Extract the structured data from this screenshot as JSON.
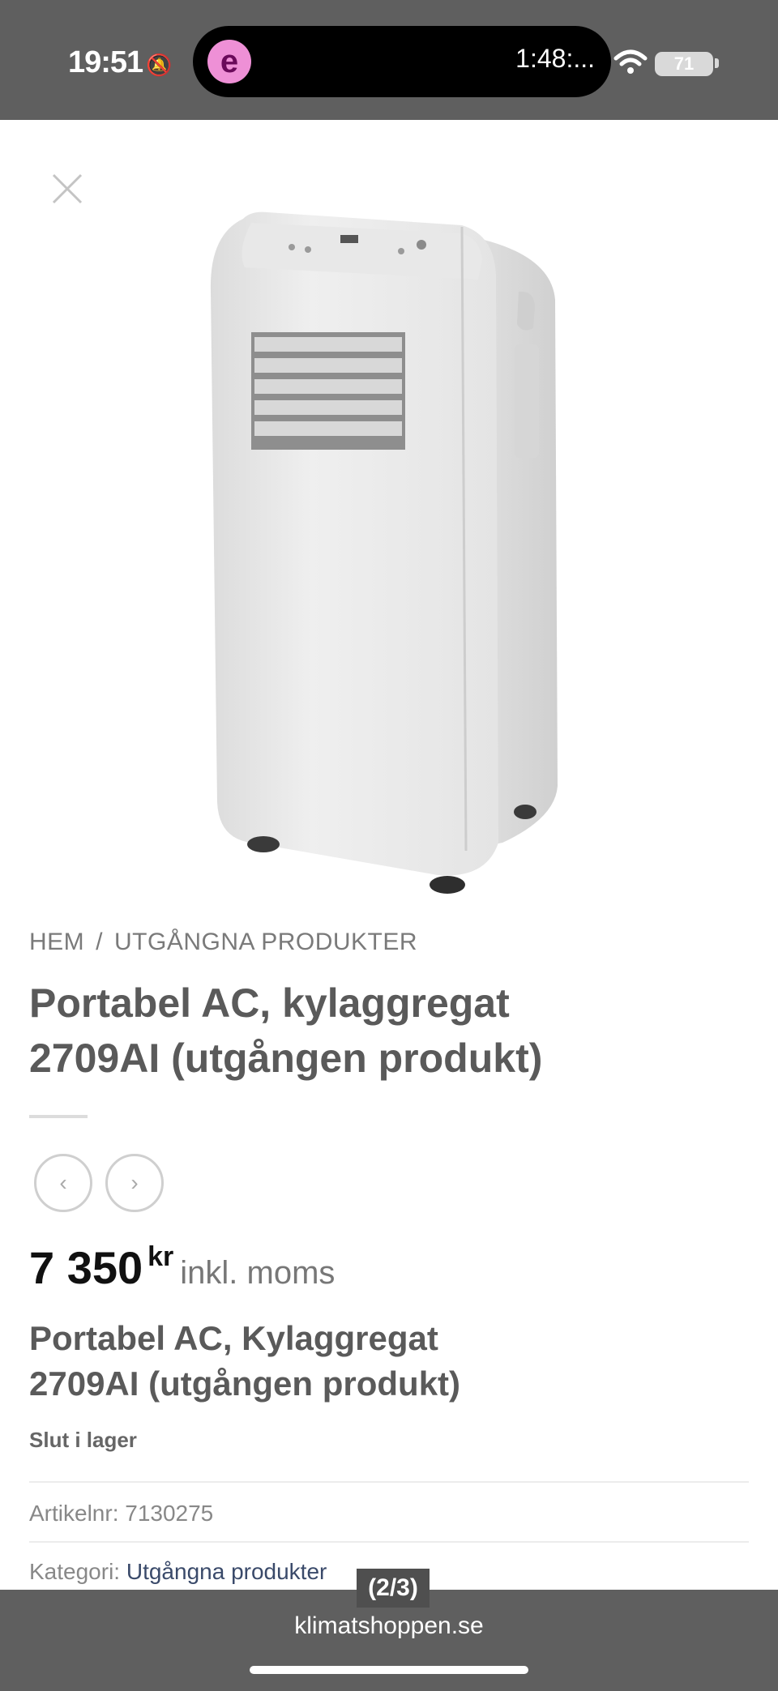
{
  "status_bar": {
    "time": "19:51",
    "island_app_letter": "e",
    "island_timer": "1:48:...",
    "battery": "71"
  },
  "breadcrumb": {
    "home": "HEM",
    "separator": "/",
    "category": "UTGÅNGNA PRODUKTER"
  },
  "product": {
    "title_line1": "Portabel AC, kylaggregat",
    "title_line2": "2709AI (utgången produkt)",
    "price_amount": "7 350",
    "price_currency": "kr",
    "price_suffix": "inkl. moms",
    "subtitle_line1": "Portabel AC, Kylaggregat",
    "subtitle_line2": "2709AI (utgången produkt)",
    "stock_status": "Slut i lager",
    "sku_label": "Artikelnr:",
    "sku_value": "7130275",
    "category_label": "Kategori:",
    "category_value": "Utgångna produkter"
  },
  "nav": {
    "prev_icon": "‹",
    "next_icon": "›"
  },
  "gallery": {
    "counter": "(2/3)"
  },
  "browser": {
    "domain": "klimatshoppen.se"
  },
  "colors": {
    "status_bar_bg": "#5f5f5f",
    "island_icon": "#ee90d6",
    "link": "#3a4a6a"
  }
}
